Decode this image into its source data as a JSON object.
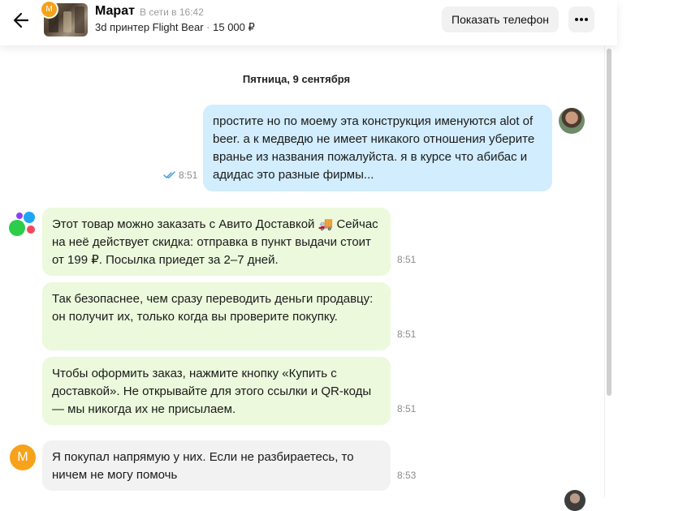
{
  "header": {
    "contact_name": "Марат",
    "contact_initial": "M",
    "status": "В сети в 16:42",
    "item_title": "3d принтер Flight Bear",
    "item_price": "15 000 ₽",
    "item_separator": "·",
    "show_phone_label": "Показать телефон",
    "more_icon": "more-horizontal-icon",
    "back_icon": "arrow-left-icon"
  },
  "chat": {
    "date_label": "Пятница, 9 сентября",
    "messages": [
      {
        "from": "me",
        "text": "простите но по моему эта конструкция именуются alot of beer. а к медведю не имеет никакого отношения уберите вранье из названия пожалуйста. я в курсе что абибас и адидас это разные фирмы...",
        "time": "8:51",
        "read": true
      },
      {
        "from": "system",
        "text": "Этот товар можно заказать с Авито Доставкой 🚚 Сейчас на неё действует скидка: отправка в пункт выдачи стоит от 199 ₽. Посылка приедет за 2–7 дней.",
        "time": "8:51"
      },
      {
        "from": "system",
        "text": "Так безопаснее, чем сразу переводить деньги продавцу: он получит их, только когда вы проверите покупку.",
        "time": "8:51"
      },
      {
        "from": "system",
        "text": "Чтобы оформить заказ, нажмите кнопку «Купить с доставкой». Не открывайте для этого ссылки и QR-коды — мы никогда их не присылаем.",
        "time": "8:51"
      },
      {
        "from": "seller",
        "text": "Я покупал напрямую у них. Если не разбираетесь, то ничем не могу помочь",
        "time": "8:53"
      }
    ]
  },
  "colors": {
    "outgoing_bubble": "#d2edfd",
    "system_bubble": "#ecf9dc",
    "incoming_bubble": "#f2f2f2",
    "avatar_orange": "#f7a21b",
    "read_check": "#3a9ad9"
  }
}
